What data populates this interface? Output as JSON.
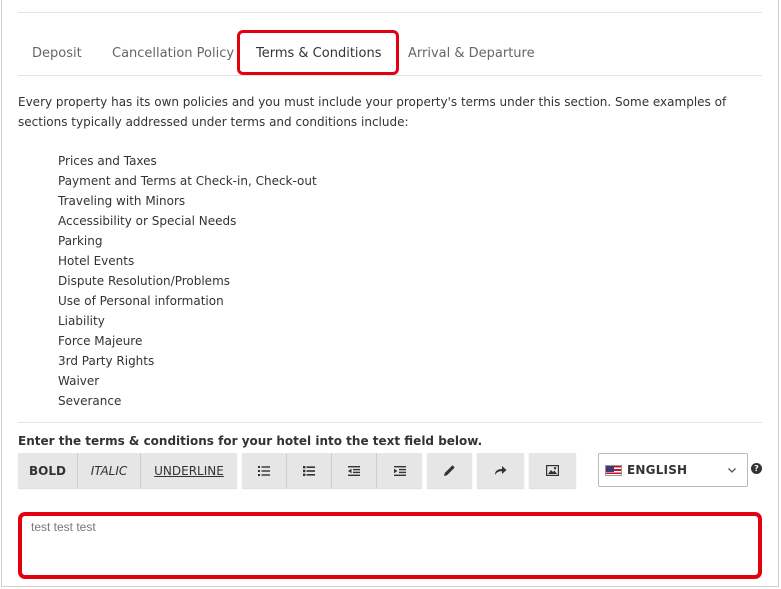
{
  "tabs": [
    {
      "label": "Deposit"
    },
    {
      "label": "Cancellation Policy"
    },
    {
      "label": "Terms & Conditions"
    },
    {
      "label": "Arrival & Departure"
    }
  ],
  "intro": "Every property has its own policies and you must include your property's terms under this section. Some examples of sections typically addressed under terms and conditions include:",
  "policy_items": [
    "Prices and Taxes",
    "Payment and Terms at Check-in, Check-out",
    "Traveling with Minors",
    "Accessibility or Special Needs",
    "Parking",
    "Hotel Events",
    "Dispute Resolution/Problems",
    "Use of Personal information",
    "Liability",
    "Force Majeure",
    "3rd Party Rights",
    "Waiver",
    "Severance"
  ],
  "instruction": "Enter the terms & conditions for your hotel into the text field below.",
  "toolbar": {
    "bold": "BOLD",
    "italic": "ITALIC",
    "underline": "UNDERLINE",
    "icons": [
      "bullet-list-icon",
      "numbered-list-icon",
      "outdent-icon",
      "indent-icon",
      "pencil-icon",
      "redo-icon",
      "image-icon"
    ]
  },
  "language": {
    "selected": "ENGLISH",
    "flag": "us-flag-icon"
  },
  "help": "?",
  "editor": {
    "value": "test test test"
  },
  "colors": {
    "highlight": "#e3000f",
    "button_bg": "#e6e6e6"
  }
}
